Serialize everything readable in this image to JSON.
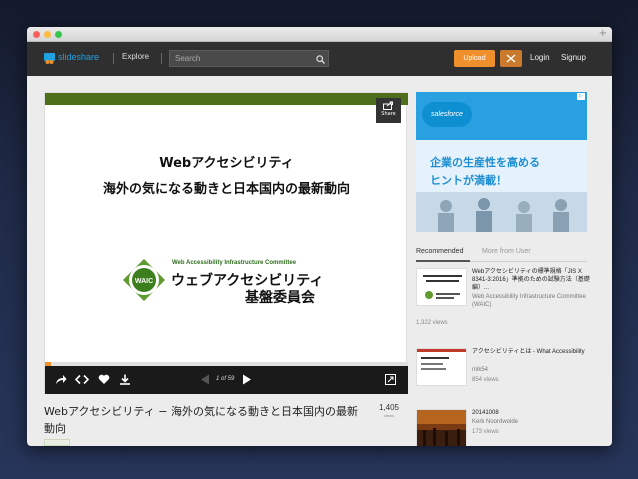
{
  "navbar": {
    "logo_text": "slideshare",
    "explore": "Explore",
    "search_placeholder": "Search",
    "upload": "Upload",
    "login": "Login",
    "signup": "Signup"
  },
  "slide": {
    "title1": "Webアクセシビリティ",
    "title2": "海外の気になる動きと日本国内の最新動向",
    "org_en": "Web Accessibility Infrastructure Committee",
    "org_jp1": "ウェブアクセシビリティ",
    "org_jp2": "基盤委員会",
    "logo_text": "WAIC",
    "share_label": "Share",
    "page_indicator": "1 of 59",
    "progress_fraction": 0.017
  },
  "ad": {
    "brand": "salesforce",
    "line1": "企業の生産性を高める",
    "line2": "ヒントが満載！"
  },
  "tabs": {
    "recommended": "Recommended",
    "more_from_user": "More from User"
  },
  "recommendations": [
    {
      "title": "Webアクセシビリティの標準規格「JIS X 8341-3:2016」準拠のための試験方法（基礎編）...",
      "author": "Web Accessibility Infrastructure Committee (WAIC)",
      "views": "1,322 views"
    },
    {
      "title": "アクセシビリティとは - What Accessibility",
      "author": "mlk54",
      "views": "854 views"
    },
    {
      "title": "20141008",
      "author": "Kerk Noordwolde",
      "views": "173 views"
    }
  ],
  "main": {
    "page_title": "Webアクセシビリティ − 海外の気になる動きと日本国内の最新動向",
    "views_count": "1,405",
    "views_label": "views"
  },
  "colors": {
    "upload_orange": "#f0902d",
    "slide_green": "#4e6e1c",
    "ad_blue": "#1e8fd3"
  }
}
